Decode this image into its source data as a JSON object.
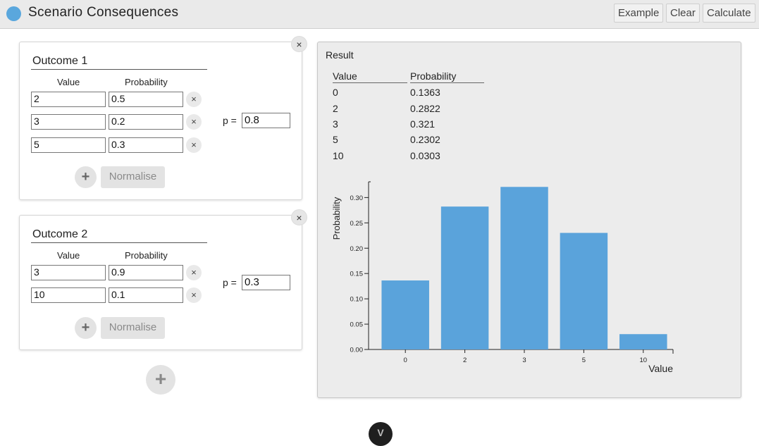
{
  "app": {
    "title": "Scenario Consequences"
  },
  "toolbar": {
    "example_label": "Example",
    "clear_label": "Clear",
    "calculate_label": "Calculate"
  },
  "outcomes": [
    {
      "name": "Outcome 1",
      "value_header": "Value",
      "probability_header": "Probability",
      "rows": [
        {
          "value": "2",
          "probability": "0.5"
        },
        {
          "value": "3",
          "probability": "0.2"
        },
        {
          "value": "5",
          "probability": "0.3"
        }
      ],
      "p_label": "p =",
      "p_value": "0.8",
      "add_label": "+",
      "normalise_label": "Normalise",
      "close_label": "×",
      "remove_label": "×"
    },
    {
      "name": "Outcome 2",
      "value_header": "Value",
      "probability_header": "Probability",
      "rows": [
        {
          "value": "3",
          "probability": "0.9"
        },
        {
          "value": "10",
          "probability": "0.1"
        }
      ],
      "p_label": "p =",
      "p_value": "0.3",
      "add_label": "+",
      "normalise_label": "Normalise",
      "close_label": "×",
      "remove_label": "×"
    }
  ],
  "add_outcome_label": "+",
  "scroll_label": "V",
  "result": {
    "title": "Result",
    "value_header": "Value",
    "probability_header": "Probability",
    "rows": [
      {
        "value": "0",
        "probability": "0.1363"
      },
      {
        "value": "2",
        "probability": "0.2822"
      },
      {
        "value": "3",
        "probability": "0.321"
      },
      {
        "value": "5",
        "probability": "0.2302"
      },
      {
        "value": "10",
        "probability": "0.0303"
      }
    ]
  },
  "colors": {
    "bar": "#5aa3db",
    "logo": "#5aa7dd"
  },
  "chart_data": {
    "type": "bar",
    "categories": [
      "0",
      "2",
      "3",
      "5",
      "10"
    ],
    "values": [
      0.1363,
      0.2822,
      0.321,
      0.2302,
      0.0303
    ],
    "xlabel": "Value",
    "ylabel": "Probability",
    "ylim": [
      0,
      0.32
    ],
    "yticks": [
      "0.00",
      "0.05",
      "0.10",
      "0.15",
      "0.20",
      "0.25",
      "0.30"
    ],
    "grid": false,
    "legend": "none"
  }
}
